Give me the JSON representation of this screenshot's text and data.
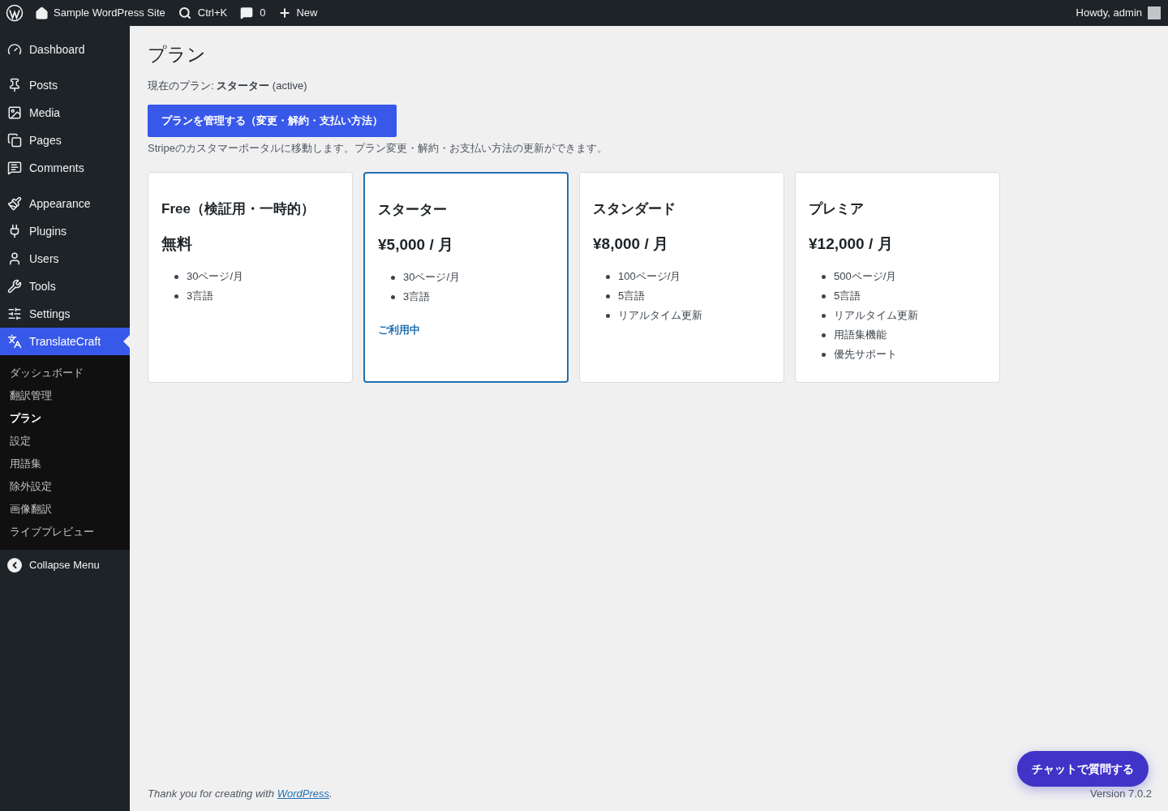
{
  "admin_bar": {
    "site_name": "Sample WordPress Site",
    "search_shortcut": "Ctrl+K",
    "comments_count": "0",
    "new_label": "New",
    "greeting": "Howdy, admin"
  },
  "sidebar": {
    "items": [
      {
        "label": "Dashboard",
        "kind": "dashboard",
        "selected": false
      },
      {
        "label": "Posts",
        "kind": "posts",
        "selected": false
      },
      {
        "label": "Media",
        "kind": "media",
        "selected": false
      },
      {
        "label": "Pages",
        "kind": "pages",
        "selected": false
      },
      {
        "label": "Comments",
        "kind": "comments",
        "selected": false
      },
      {
        "label": "Appearance",
        "kind": "appearance",
        "selected": false
      },
      {
        "label": "Plugins",
        "kind": "plugins",
        "selected": false
      },
      {
        "label": "Users",
        "kind": "users",
        "selected": false
      },
      {
        "label": "Tools",
        "kind": "tools",
        "selected": false
      },
      {
        "label": "Settings",
        "kind": "settings",
        "selected": false
      },
      {
        "label": "TranslateCraft",
        "kind": "translate",
        "selected": true,
        "children": [
          {
            "label": "ダッシュボード",
            "selected": false
          },
          {
            "label": "翻訳管理",
            "selected": false
          },
          {
            "label": "プラン",
            "selected": true
          },
          {
            "label": "設定",
            "selected": false
          },
          {
            "label": "用語集",
            "selected": false
          },
          {
            "label": "除外設定",
            "selected": false
          },
          {
            "label": "画像翻訳",
            "selected": false
          },
          {
            "label": "ライブプレビュー",
            "selected": false
          }
        ]
      }
    ],
    "collapse_label": "Collapse Menu"
  },
  "page": {
    "title": "プラン",
    "current_plan": "現在のプラン: **スターター** (active)",
    "manage_button": "プランを管理する（変更・解約・支払い方法）",
    "portal_note": "Stripeのカスタマーポータルに移動します。プラン変更・解約・お支払い方法の更新ができます。",
    "plans": [
      {
        "name": "Free（検証用・一時的）",
        "price": "無料",
        "selected": false,
        "features": [
          "30ページ/月",
          "3言語"
        ]
      },
      {
        "name": "スターター",
        "price": "¥5,000 / 月",
        "selected": true,
        "status": "ご利用中",
        "features": [
          "30ページ/月",
          "3言語"
        ]
      },
      {
        "name": "スタンダード",
        "price": "¥8,000 / 月",
        "selected": false,
        "features": [
          "100ページ/月",
          "5言語",
          "リアルタイム更新"
        ]
      },
      {
        "name": "プレミア",
        "price": "¥12,000 / 月",
        "selected": false,
        "features": [
          "500ページ/月",
          "5言語",
          "リアルタイム更新",
          "用語集機能",
          "優先サポート"
        ]
      }
    ]
  },
  "footer": {
    "thanks": "Thank you for creating with",
    "link": "WordPress",
    "link_suffix": ".",
    "version": "Version 7.0.2"
  },
  "chat_button": "チャットで質問する"
}
